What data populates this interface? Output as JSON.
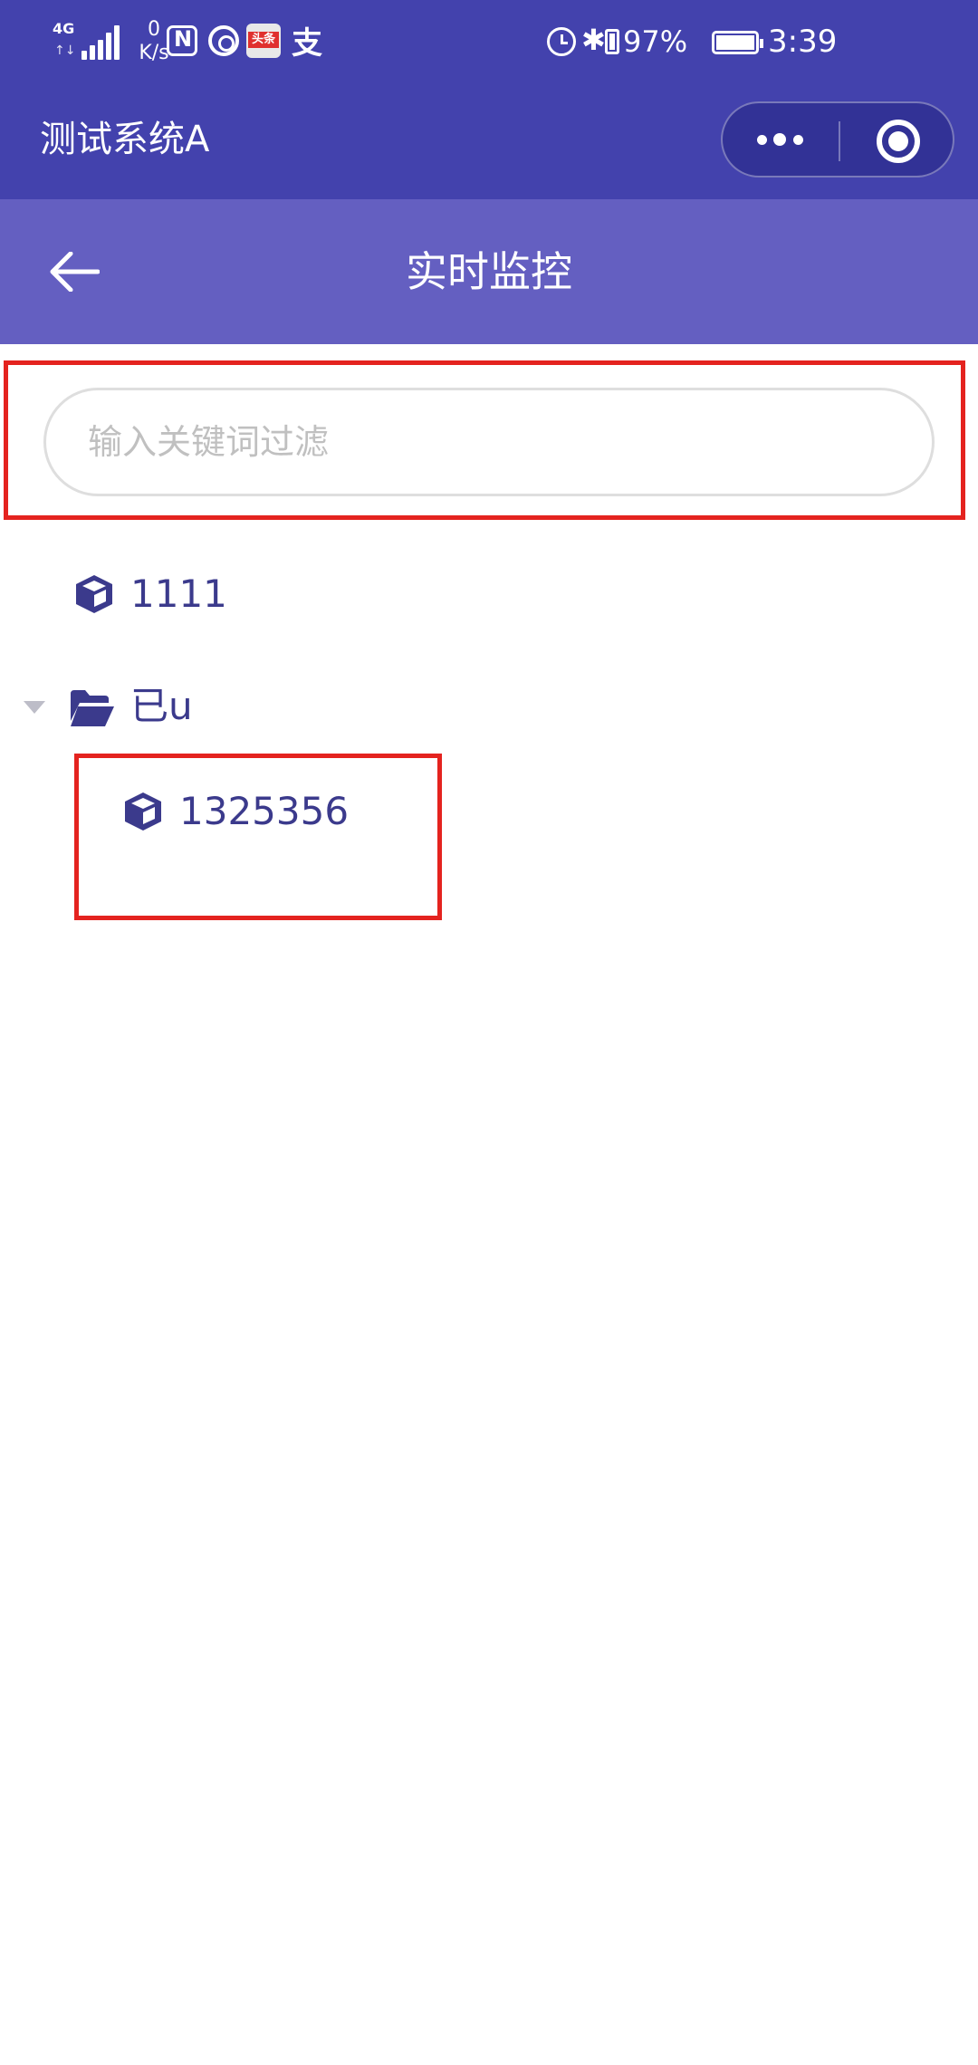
{
  "status_bar": {
    "network_type": "4G",
    "network_arrows": "↑↓",
    "speed_value": "0",
    "speed_unit": "K/s",
    "bluetooth": "✱",
    "battery_percent": "97%",
    "time": "3:39",
    "toutiao_label": "头条",
    "alipay_glyph": "支"
  },
  "title_bar": {
    "app_name": "测试系统A"
  },
  "page_header": {
    "title": "实时监控"
  },
  "search": {
    "placeholder": "输入关键词过滤",
    "value": ""
  },
  "tree": {
    "root_device": {
      "label": "1111",
      "icon": "cube-icon"
    },
    "group": {
      "label": "已u",
      "icon": "folder-open-icon",
      "expanded": true
    },
    "child_device": {
      "label": "1325356",
      "icon": "cube-icon"
    }
  },
  "colors": {
    "status_bar_bg": "#4342ad",
    "header_bg": "#645fc1",
    "node_text": "#3b3a8c",
    "highlight": "#e4231f"
  }
}
